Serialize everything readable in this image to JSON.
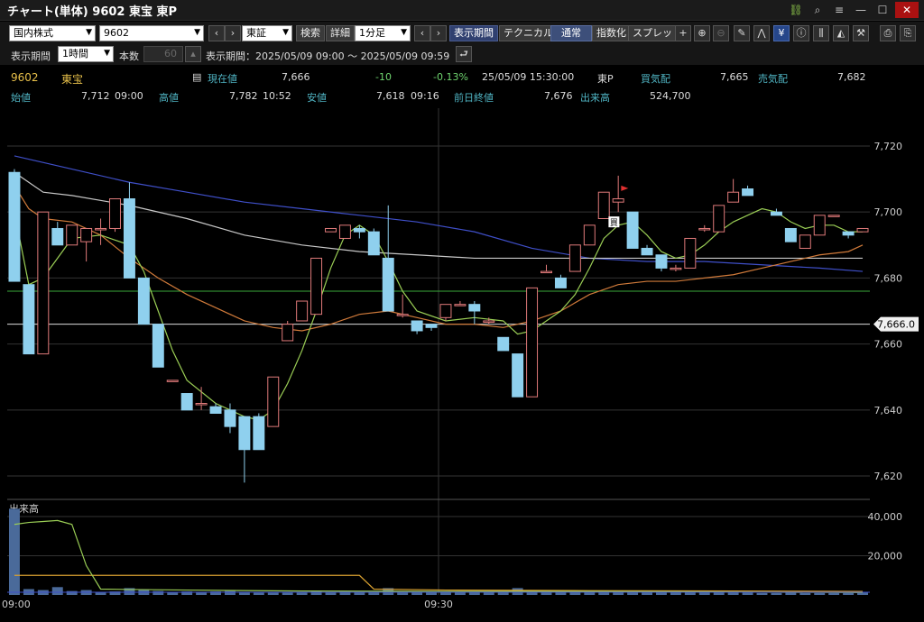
{
  "window": {
    "title": "チャート(単体) 9602 東宝 東P"
  },
  "toolbar1": {
    "market_select": "国内株式",
    "code_input": "9602",
    "exchange_select": "東証",
    "search_label": "検索",
    "detail_label": "詳細",
    "interval_select": "1分足",
    "period_label": "表示期間",
    "technical_label": "テクニカル",
    "normal_label": "通常",
    "index_label": "指数化",
    "spread_label": "スプレッド"
  },
  "toolbar2": {
    "period_label": "表示期間",
    "period_select": "1時間",
    "count_label": "本数",
    "count_value": "60",
    "range_label": "表示期間：",
    "range_value": "2025/05/09 09:00 ～ 2025/05/09 09:59"
  },
  "quote": {
    "code": "9602",
    "name": "東宝",
    "current_label": "現在値",
    "current_value": "7,666",
    "change": "-10",
    "change_pct": "-0.13%",
    "datetime": "25/05/09  15:30:00",
    "market": "東P",
    "bid_label": "買気配",
    "bid_value": "7,665",
    "ask_label": "売気配",
    "ask_value": "7,682",
    "open_label": "始値",
    "open_value": "7,712",
    "open_time": "09:00",
    "high_label": "高値",
    "high_value": "7,782",
    "high_time": "10:52",
    "low_label": "安値",
    "low_value": "7,618",
    "low_time": "09:16",
    "prev_close_label": "前日終値",
    "prev_close_value": "7,676",
    "volume_label": "出来高",
    "volume_value": "524,700"
  },
  "chart_data": {
    "type": "candlestick",
    "y_ticks": [
      "7,720",
      "7,700",
      "7,680",
      "7,660",
      "7,640",
      "7,620"
    ],
    "current_price_label": "7,666.0",
    "x_ticks": [
      "09:00",
      "09:30"
    ],
    "volume_label": "出来高",
    "volume_ticks": [
      "40,000",
      "20,000"
    ],
    "buy_marker": "買",
    "ylim": [
      7614,
      7726
    ],
    "x_range": [
      0,
      59
    ],
    "candles": [
      {
        "t": 0,
        "o": 7712,
        "h": 7713,
        "l": 7679,
        "c": 7679
      },
      {
        "t": 1,
        "o": 7678,
        "h": 7678,
        "l": 7657,
        "c": 7657
      },
      {
        "t": 2,
        "o": 7657,
        "h": 7700,
        "l": 7657,
        "c": 7700
      },
      {
        "t": 3,
        "o": 7695,
        "h": 7697,
        "l": 7690,
        "c": 7690
      },
      {
        "t": 4,
        "o": 7690,
        "h": 7696,
        "l": 7690,
        "c": 7696
      },
      {
        "t": 5,
        "o": 7691,
        "h": 7695,
        "l": 7685,
        "c": 7695
      },
      {
        "t": 6,
        "o": 7695,
        "h": 7698,
        "l": 7690,
        "c": 7695
      },
      {
        "t": 7,
        "o": 7695,
        "h": 7704,
        "l": 7694,
        "c": 7704
      },
      {
        "t": 8,
        "o": 7704,
        "h": 7709,
        "l": 7680,
        "c": 7680
      },
      {
        "t": 9,
        "o": 7680,
        "h": 7680,
        "l": 7666,
        "c": 7666
      },
      {
        "t": 10,
        "o": 7666,
        "h": 7666,
        "l": 7653,
        "c": 7653
      },
      {
        "t": 11,
        "o": 7649,
        "h": 7649,
        "l": 7649,
        "c": 7649
      },
      {
        "t": 12,
        "o": 7645,
        "h": 7645,
        "l": 7640,
        "c": 7640
      },
      {
        "t": 13,
        "o": 7642,
        "h": 7647,
        "l": 7640,
        "c": 7642
      },
      {
        "t": 14,
        "o": 7641,
        "h": 7642,
        "l": 7639,
        "c": 7639
      },
      {
        "t": 15,
        "o": 7640,
        "h": 7642,
        "l": 7633,
        "c": 7635
      },
      {
        "t": 16,
        "o": 7638,
        "h": 7638,
        "l": 7618,
        "c": 7628
      },
      {
        "t": 17,
        "o": 7638,
        "h": 7639,
        "l": 7628,
        "c": 7628
      },
      {
        "t": 18,
        "o": 7635,
        "h": 7650,
        "l": 7635,
        "c": 7650
      },
      {
        "t": 19,
        "o": 7661,
        "h": 7667,
        "l": 7661,
        "c": 7666
      },
      {
        "t": 20,
        "o": 7667,
        "h": 7673,
        "l": 7667,
        "c": 7673
      },
      {
        "t": 21,
        "o": 7669,
        "h": 7686,
        "l": 7669,
        "c": 7686
      },
      {
        "t": 22,
        "o": 7694,
        "h": 7695,
        "l": 7694,
        "c": 7695
      },
      {
        "t": 23,
        "o": 7692,
        "h": 7696,
        "l": 7692,
        "c": 7696
      },
      {
        "t": 24,
        "o": 7695,
        "h": 7696,
        "l": 7692,
        "c": 7694
      },
      {
        "t": 25,
        "o": 7694,
        "h": 7695,
        "l": 7687,
        "c": 7687
      },
      {
        "t": 26,
        "o": 7686,
        "h": 7702,
        "l": 7670,
        "c": 7670
      },
      {
        "t": 27,
        "o": 7669,
        "h": 7675,
        "l": 7668,
        "c": 7669
      },
      {
        "t": 28,
        "o": 7667,
        "h": 7667,
        "l": 7663,
        "c": 7664
      },
      {
        "t": 29,
        "o": 7666,
        "h": 7666,
        "l": 7664,
        "c": 7665
      },
      {
        "t": 30,
        "o": 7668,
        "h": 7672,
        "l": 7667,
        "c": 7672
      },
      {
        "t": 31,
        "o": 7672,
        "h": 7673,
        "l": 7672,
        "c": 7672
      },
      {
        "t": 32,
        "o": 7672,
        "h": 7673,
        "l": 7666,
        "c": 7670
      },
      {
        "t": 33,
        "o": 7667,
        "h": 7668,
        "l": 7666,
        "c": 7667
      },
      {
        "t": 34,
        "o": 7662,
        "h": 7662,
        "l": 7658,
        "c": 7658
      },
      {
        "t": 35,
        "o": 7657,
        "h": 7657,
        "l": 7644,
        "c": 7644
      },
      {
        "t": 36,
        "o": 7644,
        "h": 7677,
        "l": 7644,
        "c": 7677
      },
      {
        "t": 37,
        "o": 7682,
        "h": 7684,
        "l": 7682,
        "c": 7682
      },
      {
        "t": 38,
        "o": 7680,
        "h": 7681,
        "l": 7677,
        "c": 7677
      },
      {
        "t": 39,
        "o": 7682,
        "h": 7690,
        "l": 7682,
        "c": 7690
      },
      {
        "t": 40,
        "o": 7690,
        "h": 7696,
        "l": 7690,
        "c": 7696
      },
      {
        "t": 41,
        "o": 7698,
        "h": 7706,
        "l": 7698,
        "c": 7706
      },
      {
        "t": 42,
        "o": 7703,
        "h": 7711,
        "l": 7700,
        "c": 7704
      },
      {
        "t": 43,
        "o": 7700,
        "h": 7700,
        "l": 7689,
        "c": 7689
      },
      {
        "t": 44,
        "o": 7689,
        "h": 7690,
        "l": 7687,
        "c": 7687
      },
      {
        "t": 45,
        "o": 7687,
        "h": 7687,
        "l": 7682,
        "c": 7683
      },
      {
        "t": 46,
        "o": 7683,
        "h": 7684,
        "l": 7682,
        "c": 7683
      },
      {
        "t": 47,
        "o": 7683,
        "h": 7692,
        "l": 7683,
        "c": 7692
      },
      {
        "t": 48,
        "o": 7695,
        "h": 7696,
        "l": 7694,
        "c": 7695
      },
      {
        "t": 49,
        "o": 7694,
        "h": 7702,
        "l": 7694,
        "c": 7702
      },
      {
        "t": 50,
        "o": 7703,
        "h": 7710,
        "l": 7703,
        "c": 7706
      },
      {
        "t": 51,
        "o": 7707,
        "h": 7708,
        "l": 7705,
        "c": 7705
      },
      {
        "t": 53,
        "o": 7700,
        "h": 7701,
        "l": 7699,
        "c": 7699
      },
      {
        "t": 54,
        "o": 7695,
        "h": 7695,
        "l": 7691,
        "c": 7691
      },
      {
        "t": 55,
        "o": 7689,
        "h": 7693,
        "l": 7689,
        "c": 7693
      },
      {
        "t": 56,
        "o": 7693,
        "h": 7699,
        "l": 7693,
        "c": 7699
      },
      {
        "t": 57,
        "o": 7699,
        "h": 7699,
        "l": 7699,
        "c": 7699
      },
      {
        "t": 58,
        "o": 7694,
        "h": 7694,
        "l": 7692,
        "c": 7693
      },
      {
        "t": 59,
        "o": 7694,
        "h": 7695,
        "l": 7694,
        "c": 7695
      }
    ],
    "ma_short": [
      [
        0,
        7700
      ],
      [
        1,
        7678
      ],
      [
        2,
        7680
      ],
      [
        4,
        7692
      ],
      [
        6,
        7693
      ],
      [
        8,
        7690
      ],
      [
        9,
        7682
      ],
      [
        10,
        7670
      ],
      [
        11,
        7658
      ],
      [
        12,
        7649
      ],
      [
        14,
        7642
      ],
      [
        16,
        7638
      ],
      [
        17,
        7637
      ],
      [
        18,
        7640
      ],
      [
        19,
        7648
      ],
      [
        20,
        7658
      ],
      [
        21,
        7670
      ],
      [
        22,
        7683
      ],
      [
        23,
        7693
      ],
      [
        24,
        7696
      ],
      [
        25,
        7693
      ],
      [
        26,
        7685
      ],
      [
        27,
        7676
      ],
      [
        28,
        7670
      ],
      [
        30,
        7667
      ],
      [
        32,
        7668
      ],
      [
        34,
        7667
      ],
      [
        35,
        7663
      ],
      [
        36,
        7664
      ],
      [
        37,
        7667
      ],
      [
        38,
        7670
      ],
      [
        39,
        7675
      ],
      [
        40,
        7683
      ],
      [
        41,
        7692
      ],
      [
        42,
        7696
      ],
      [
        43,
        7697
      ],
      [
        44,
        7693
      ],
      [
        45,
        7688
      ],
      [
        46,
        7686
      ],
      [
        47,
        7687
      ],
      [
        48,
        7690
      ],
      [
        49,
        7694
      ],
      [
        50,
        7697
      ],
      [
        51,
        7699
      ],
      [
        52,
        7701
      ],
      [
        53,
        7700
      ],
      [
        54,
        7697
      ],
      [
        55,
        7695
      ],
      [
        56,
        7696
      ],
      [
        57,
        7696
      ],
      [
        58,
        7694
      ],
      [
        59,
        7694
      ]
    ],
    "ma_mid": [
      [
        0,
        7708
      ],
      [
        1,
        7701
      ],
      [
        2,
        7698
      ],
      [
        4,
        7697
      ],
      [
        6,
        7693
      ],
      [
        8,
        7686
      ],
      [
        10,
        7680
      ],
      [
        12,
        7675
      ],
      [
        14,
        7671
      ],
      [
        16,
        7667
      ],
      [
        18,
        7665
      ],
      [
        20,
        7664
      ],
      [
        22,
        7666
      ],
      [
        24,
        7669
      ],
      [
        26,
        7670
      ],
      [
        28,
        7668
      ],
      [
        30,
        7666
      ],
      [
        32,
        7666
      ],
      [
        34,
        7665
      ],
      [
        36,
        7667
      ],
      [
        38,
        7670
      ],
      [
        40,
        7675
      ],
      [
        42,
        7678
      ],
      [
        44,
        7679
      ],
      [
        46,
        7679
      ],
      [
        48,
        7680
      ],
      [
        50,
        7681
      ],
      [
        52,
        7683
      ],
      [
        54,
        7685
      ],
      [
        56,
        7687
      ],
      [
        58,
        7688
      ],
      [
        59,
        7690
      ]
    ],
    "ma_long": [
      [
        0,
        7712
      ],
      [
        1,
        7709
      ],
      [
        2,
        7706
      ],
      [
        4,
        7705
      ],
      [
        8,
        7702
      ],
      [
        12,
        7698
      ],
      [
        16,
        7693
      ],
      [
        20,
        7690
      ],
      [
        24,
        7688
      ],
      [
        28,
        7687
      ],
      [
        32,
        7686
      ],
      [
        36,
        7686
      ],
      [
        40,
        7686
      ],
      [
        44,
        7686
      ],
      [
        48,
        7686
      ],
      [
        52,
        7686
      ],
      [
        56,
        7686
      ],
      [
        59,
        7686
      ]
    ],
    "ma_trend": [
      [
        0,
        7717
      ],
      [
        4,
        7713
      ],
      [
        8,
        7709
      ],
      [
        12,
        7706
      ],
      [
        16,
        7703
      ],
      [
        20,
        7701
      ],
      [
        24,
        7699
      ],
      [
        28,
        7697
      ],
      [
        32,
        7694
      ],
      [
        36,
        7689
      ],
      [
        40,
        7686
      ],
      [
        44,
        7685
      ],
      [
        48,
        7685
      ],
      [
        52,
        7684
      ],
      [
        56,
        7683
      ],
      [
        59,
        7682
      ]
    ],
    "green_level": 7676,
    "current_level": 7666,
    "volume": [
      44000,
      3000,
      2500,
      4000,
      2000,
      2500,
      1500,
      1800,
      3500,
      2500,
      2000,
      1500,
      1800,
      1500,
      1800,
      2000,
      1500,
      1600,
      1500,
      1400,
      1500,
      2000,
      1500,
      1800,
      1500,
      1600,
      3500,
      1500,
      1500,
      1400,
      1200,
      1500,
      1300,
      1500,
      2000,
      3500,
      2500,
      2500,
      2000,
      1500,
      2000,
      2000,
      2000,
      1500,
      1500,
      1500,
      1500,
      1200,
      1200,
      1200,
      1500,
      1200,
      1000,
      1000,
      1200,
      1000,
      1000,
      1000,
      1000,
      1200
    ],
    "vol_ma_short": [
      [
        0,
        36000
      ],
      [
        1,
        37000
      ],
      [
        2,
        37500
      ],
      [
        3,
        38000
      ],
      [
        4,
        36000
      ],
      [
        5,
        15000
      ],
      [
        6,
        3000
      ],
      [
        8,
        2800
      ],
      [
        12,
        2500
      ],
      [
        20,
        2000
      ],
      [
        30,
        1800
      ],
      [
        40,
        1800
      ],
      [
        50,
        1500
      ],
      [
        59,
        1200
      ]
    ],
    "vol_ma_long": [
      [
        0,
        10000
      ],
      [
        10,
        10000
      ],
      [
        20,
        10000
      ],
      [
        24,
        10000
      ],
      [
        25,
        3000
      ],
      [
        30,
        2500
      ],
      [
        40,
        2200
      ],
      [
        50,
        2000
      ],
      [
        59,
        1800
      ]
    ],
    "vol_ylim": [
      0,
      46000
    ]
  }
}
